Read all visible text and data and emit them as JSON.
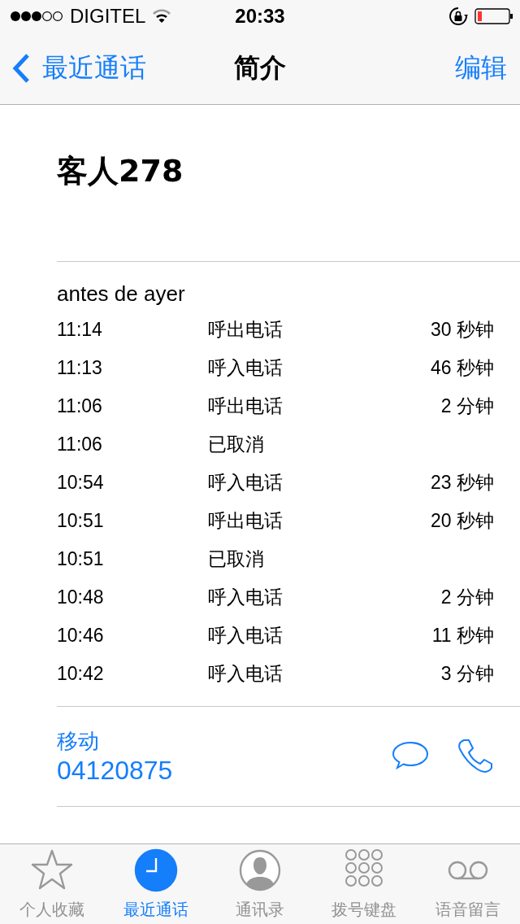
{
  "status_bar": {
    "carrier": "DIGITEL",
    "time": "20:33"
  },
  "nav": {
    "back": "最近通话",
    "title": "简介",
    "edit": "编辑"
  },
  "contact": {
    "name": "客人278"
  },
  "calls": {
    "date": "antes de ayer",
    "rows": [
      {
        "time": "11:14",
        "type": "呼出电话",
        "duration": "30 秒钟"
      },
      {
        "time": "11:13",
        "type": "呼入电话",
        "duration": "46 秒钟"
      },
      {
        "time": "11:06",
        "type": "呼出电话",
        "duration": "2 分钟"
      },
      {
        "time": "11:06",
        "type": "已取消"
      },
      {
        "time": "10:54",
        "type": "呼入电话",
        "duration": "23 秒钟"
      },
      {
        "time": "10:51",
        "type": "呼出电话",
        "duration": "20 秒钟"
      },
      {
        "time": "10:51",
        "type": "已取消"
      },
      {
        "time": "10:48",
        "type": "呼入电话",
        "duration": "2 分钟"
      },
      {
        "time": "10:46",
        "type": "呼入电话",
        "duration": "11 秒钟"
      },
      {
        "time": "10:42",
        "type": "呼入电话",
        "duration": "3 分钟"
      }
    ]
  },
  "phone": {
    "label": "移动",
    "number": "04120875"
  },
  "tab_bar": [
    {
      "kind": "star",
      "label": "个人收藏",
      "selected": false
    },
    {
      "kind": "clock",
      "label": "最近通话",
      "selected": true
    },
    {
      "kind": "person",
      "label": "通讯录",
      "selected": false
    },
    {
      "kind": "keypad",
      "label": "拨号键盘",
      "selected": false
    },
    {
      "kind": "voicemail",
      "label": "语音留言",
      "selected": false
    }
  ]
}
